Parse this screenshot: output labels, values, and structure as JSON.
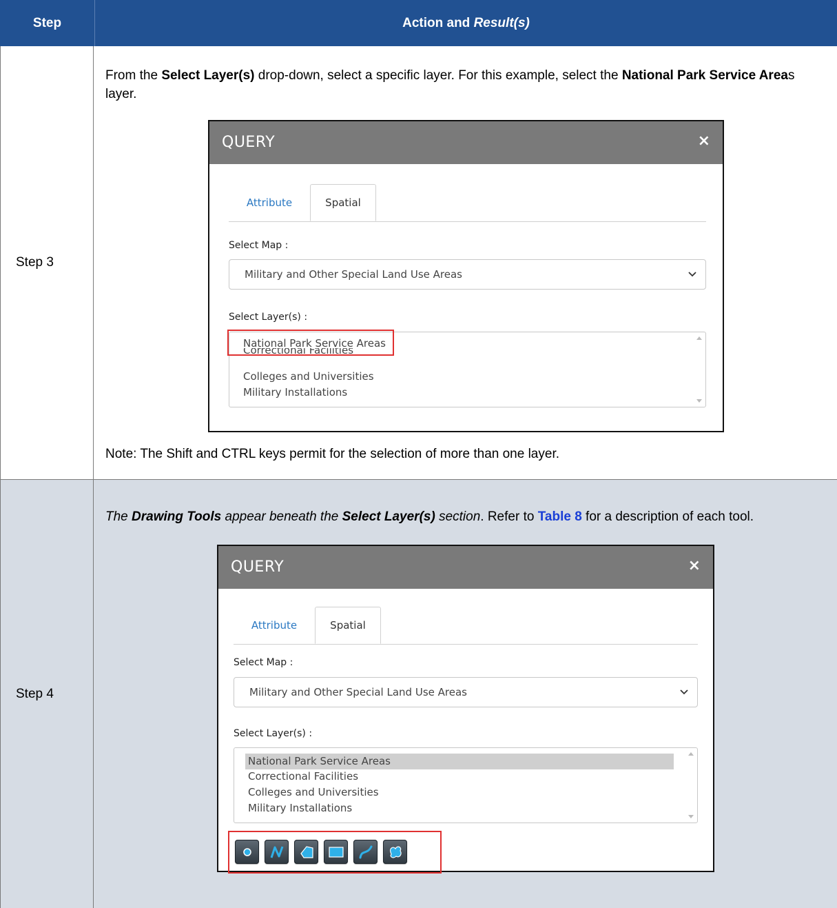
{
  "header": {
    "step": "Step",
    "action_prefix": "Action and ",
    "action_italic": "Result(s)"
  },
  "step3": {
    "label": "Step 3",
    "instruction": {
      "t1": "From the ",
      "b1": "Select Layer(s)",
      "t2": " drop-down, select a specific layer. For this example, select the ",
      "b2": "National Park Service Area",
      "t3": "s layer."
    },
    "note": "Note: The Shift and CTRL keys permit for the selection of more than one layer."
  },
  "step4": {
    "label": "Step 4",
    "instruction": {
      "i1": "The ",
      "bi1": "Drawing Tools",
      "i2": " appear beneath the ",
      "bi2": "Select Layer(s)",
      "i3": " section",
      "t1": ". Refer to ",
      "link": "Table 8",
      "t2": " for a description of each tool."
    }
  },
  "dialog": {
    "title": "QUERY",
    "close": "×",
    "tab_attribute": "Attribute",
    "tab_spatial": "Spatial",
    "select_map_label": "Select Map :",
    "select_map_value": "Military and Other Special Land Use Areas",
    "select_layers_label": "Select Layer(s) :",
    "layers": [
      "National Park Service Areas",
      "Correctional Facilities",
      "Colleges and Universities",
      "Military Installations"
    ]
  },
  "tools": [
    {
      "name": "point-tool-icon"
    },
    {
      "name": "polyline-tool-icon"
    },
    {
      "name": "polygon-tool-icon"
    },
    {
      "name": "rectangle-tool-icon"
    },
    {
      "name": "freehand-polyline-tool-icon"
    },
    {
      "name": "freehand-polygon-tool-icon"
    }
  ],
  "colors": {
    "header_bg": "#215192",
    "row_alt_bg": "#d6dce4",
    "link": "#1a3fd6",
    "highlight_border": "#e03030",
    "dialog_title_bg": "#7a7a7a"
  }
}
